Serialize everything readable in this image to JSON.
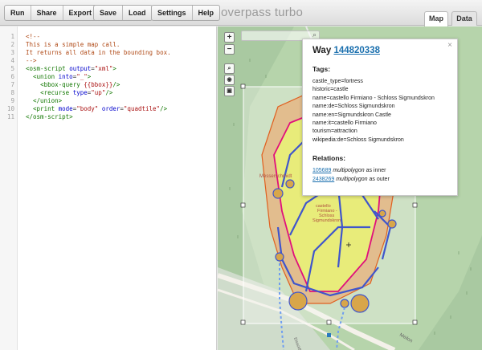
{
  "toolbar": {
    "run": "Run",
    "share": "Share",
    "export": "Export",
    "save": "Save",
    "load": "Load",
    "settings": "Settings",
    "help": "Help",
    "title": "overpass turbo"
  },
  "tabs": {
    "map": "Map",
    "data": "Data"
  },
  "editor": {
    "line_numbers": [
      "1",
      "2",
      "3",
      "4",
      "5",
      "6",
      "7",
      "8",
      "9",
      "10",
      "11"
    ],
    "lines": [
      [
        {
          "c": "cm",
          "t": "<!--"
        }
      ],
      [
        {
          "c": "cm",
          "t": "This is a simple map call."
        }
      ],
      [
        {
          "c": "cm",
          "t": "It returns all data in the bounding box."
        }
      ],
      [
        {
          "c": "cm",
          "t": "-->"
        }
      ],
      [
        {
          "c": "tag",
          "t": "<osm-script "
        },
        {
          "c": "attr",
          "t": "output"
        },
        {
          "c": "plain",
          "t": "="
        },
        {
          "c": "str",
          "t": "\"xml\""
        },
        {
          "c": "tag",
          "t": ">"
        }
      ],
      [
        {
          "c": "plain",
          "t": "  "
        },
        {
          "c": "tag",
          "t": "<union "
        },
        {
          "c": "attr",
          "t": "into"
        },
        {
          "c": "plain",
          "t": "="
        },
        {
          "c": "str",
          "t": "\"_\""
        },
        {
          "c": "tag",
          "t": ">"
        }
      ],
      [
        {
          "c": "plain",
          "t": "    "
        },
        {
          "c": "tag",
          "t": "<bbox-query "
        },
        {
          "c": "str",
          "t": "{{bbox}}"
        },
        {
          "c": "tag",
          "t": "/>"
        }
      ],
      [
        {
          "c": "plain",
          "t": "    "
        },
        {
          "c": "tag",
          "t": "<recurse "
        },
        {
          "c": "attr",
          "t": "type"
        },
        {
          "c": "plain",
          "t": "="
        },
        {
          "c": "str",
          "t": "\"up\""
        },
        {
          "c": "tag",
          "t": "/>"
        }
      ],
      [
        {
          "c": "plain",
          "t": "  "
        },
        {
          "c": "tag",
          "t": "</union>"
        }
      ],
      [
        {
          "c": "plain",
          "t": "  "
        },
        {
          "c": "tag",
          "t": "<print "
        },
        {
          "c": "attr",
          "t": "mode"
        },
        {
          "c": "plain",
          "t": "="
        },
        {
          "c": "str",
          "t": "\"body\""
        },
        {
          "c": "plain",
          "t": " "
        },
        {
          "c": "attr",
          "t": "order"
        },
        {
          "c": "plain",
          "t": "="
        },
        {
          "c": "str",
          "t": "\"quadtile\""
        },
        {
          "c": "tag",
          "t": "/>"
        }
      ],
      [
        {
          "c": "tag",
          "t": "</osm-script>"
        }
      ]
    ]
  },
  "map": {
    "zoom_in": "+",
    "zoom_out": "−",
    "labels": {
      "messe": "Messerschmidt",
      "castle_1": "castello",
      "castle_2": "Firmiano -",
      "castle_3": "Schloss",
      "castle_4": "Sigmundskron",
      "road": "Meilon",
      "road_vertical": "Eisackfluss"
    }
  },
  "popup": {
    "close": "×",
    "kind": "Way",
    "id": "144820338",
    "tags_heading": "Tags:",
    "tags": [
      "castle_type=fortress",
      "historic=castle",
      "name=castello Firmiano - Schloss Sigmundskron",
      "name:de=Schloss Sigmundskron",
      "name:en=Sigmundskron Castle",
      "name:it=castello Firmiano",
      "tourism=attraction",
      "wikipedia:de=Schloss Sigmundskron"
    ],
    "relations_heading": "Relations:",
    "relations": [
      {
        "id": "105689",
        "type": "multipolygon",
        "role": "as inner"
      },
      {
        "id": "2438269",
        "type": "multipolygon",
        "role": "as outer"
      }
    ]
  }
}
